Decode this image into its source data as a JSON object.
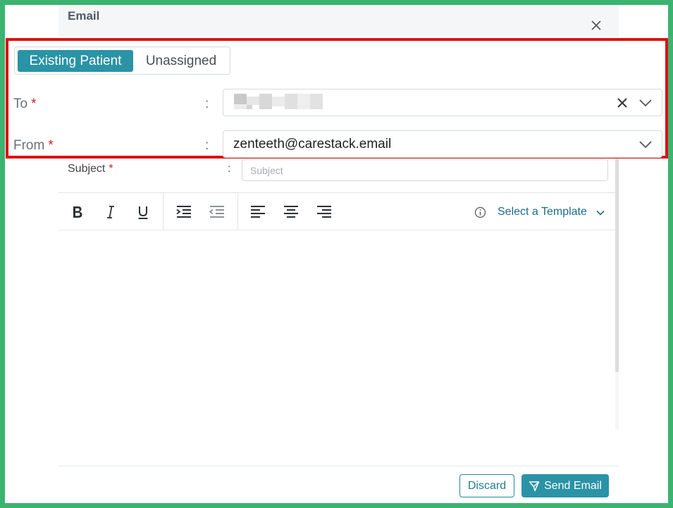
{
  "modal": {
    "title": "Email"
  },
  "recipient_toggle": {
    "options": [
      "Existing Patient",
      "Unassigned"
    ],
    "selected": "Existing Patient"
  },
  "fields": {
    "to_label": "To",
    "from_label": "From",
    "from_value": "zenteeth@carestack.email",
    "subject_label": "Subject",
    "subject_placeholder": "Subject",
    "required_mark": "*",
    "separator": ":"
  },
  "toolbar": {
    "template_label": "Select a Template"
  },
  "footer": {
    "discard_label": "Discard",
    "send_label": "Send Email"
  },
  "colors": {
    "accent": "#2a93a6",
    "required": "#cc1f1f",
    "highlight_border": "#dd1111",
    "frame": "#3cb371"
  },
  "icons": [
    "close-icon",
    "clear-icon",
    "chevron-down-icon",
    "bold-icon",
    "italic-icon",
    "underline-icon",
    "indent-icon",
    "outdent-icon",
    "align-left-icon",
    "align-center-icon",
    "align-right-icon",
    "info-icon",
    "send-icon"
  ]
}
